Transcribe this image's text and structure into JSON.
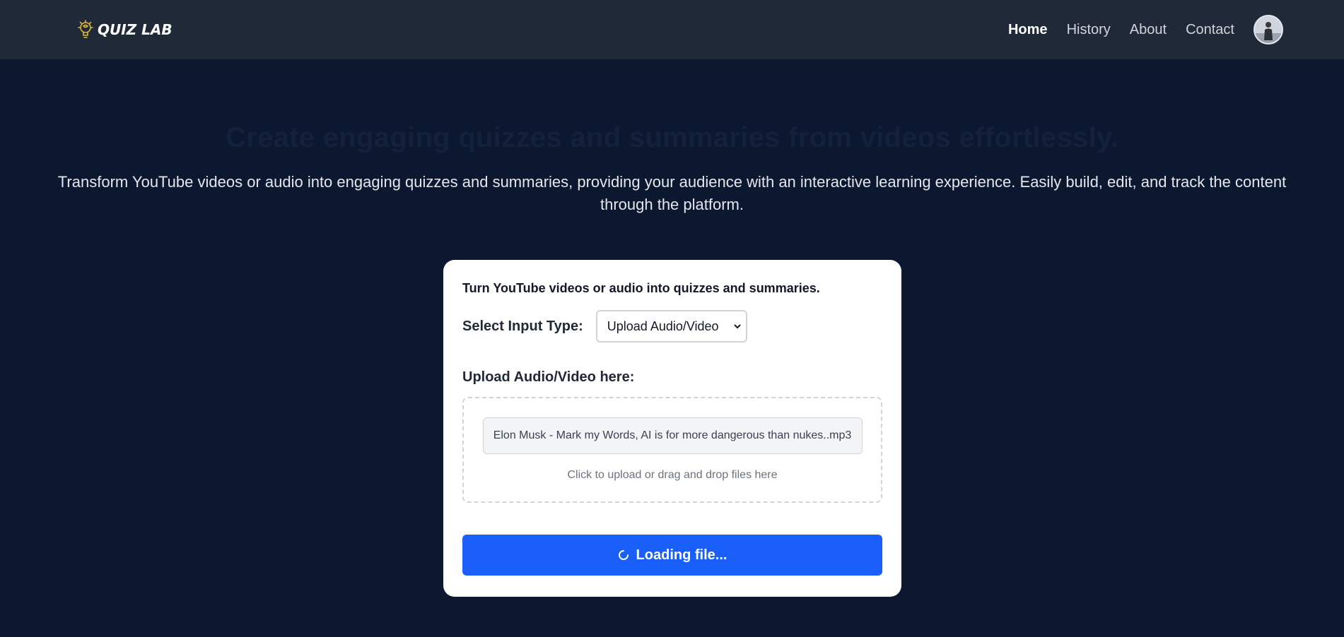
{
  "nav": {
    "brand": "QUIZ LAB",
    "links": [
      "Home",
      "History",
      "About",
      "Contact"
    ],
    "active": "Home"
  },
  "hero": {
    "title": "Create engaging quizzes and summaries from videos effortlessly.",
    "description": "Transform YouTube videos or audio into engaging quizzes and summaries, providing your audience with an interactive learning experience. Easily build, edit, and track the content through the platform."
  },
  "card": {
    "heading": "Turn YouTube videos or audio into quizzes and summaries.",
    "select_label": "Select Input Type:",
    "select_value": "Upload Audio/Video",
    "upload_label": "Upload Audio/Video here:",
    "file_name": "Elon Musk - Mark my Words, AI is for more dangerous than nukes..mp3",
    "drop_hint": "Click to upload or drag and drop files here",
    "button_label": "Loading file..."
  },
  "colors": {
    "background": "#0b1830",
    "navbar": "#1f2937",
    "primary_button": "#1a5ffa",
    "brand_icon": "#e0b73a"
  },
  "icons": {
    "brand": "lightbulb-brain-icon",
    "select": "chevron-down-icon",
    "spinner": "spinner-icon",
    "avatar": "user-avatar"
  }
}
